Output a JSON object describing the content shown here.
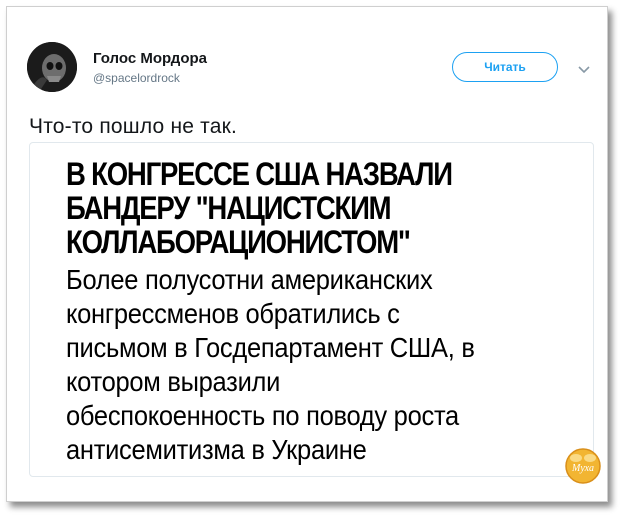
{
  "tweet": {
    "author_name": "Голос Мордора",
    "author_handle": "@spacelordrock",
    "follow_label": "Читать",
    "text": "Что-то пошло не так."
  },
  "card": {
    "headline_lines": [
      "В КОНГРЕССЕ США НАЗВАЛИ",
      "БАНДЕРУ \"НАЦИСТСКИМ",
      "КОЛЛАБОРАЦИОНИСТОМ\""
    ],
    "body_lines": [
      "Более полусотни американских",
      "конгрессменов обратились с",
      "письмом в Госдепартамент США, в",
      "котором выразили",
      "обеспокоенность по поводу роста",
      "антисемитизма в Украине"
    ]
  },
  "watermark": {
    "text": "Муха"
  },
  "colors": {
    "accent": "#1da1f2",
    "text_dark": "#14171a",
    "text_muted": "#657786",
    "card_border": "#e1e8ed"
  },
  "icons": {
    "avatar": "skull-avatar",
    "menu": "chevron-down-icon",
    "logo": "fly-logo"
  }
}
